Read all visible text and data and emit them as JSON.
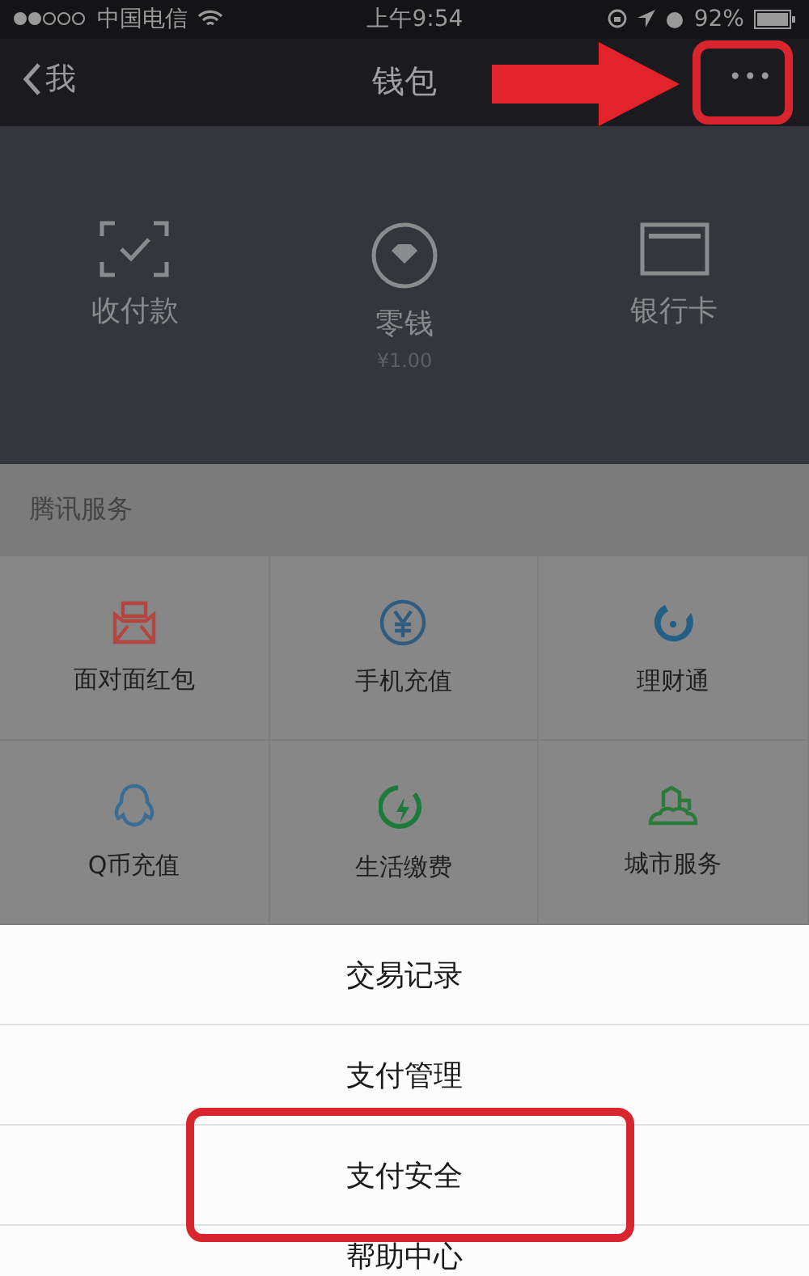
{
  "status_bar": {
    "carrier": "中国电信",
    "time": "上午9:54",
    "battery": "92%"
  },
  "nav": {
    "back_label": "我",
    "title": "钱包",
    "more": "•••",
    "more_annotated": true
  },
  "wallet_items": [
    {
      "label": "收付款"
    },
    {
      "label": "零钱",
      "sub": "¥1.00"
    },
    {
      "label": "银行卡"
    }
  ],
  "section_title": "腾讯服务",
  "services": [
    {
      "label": "面对面红包",
      "color": "#b5453f"
    },
    {
      "label": "手机充值",
      "color": "#2f5d80"
    },
    {
      "label": "理财通",
      "color": "#245f86"
    },
    {
      "label": "Q币充值",
      "color": "#3a6d93"
    },
    {
      "label": "生活缴费",
      "color": "#1d7a3a"
    },
    {
      "label": "城市服务",
      "color": "#2a7a3c"
    }
  ],
  "action_sheet": [
    {
      "label": "交易记录",
      "annotated": false
    },
    {
      "label": "支付管理",
      "annotated": false
    },
    {
      "label": "支付安全",
      "annotated": true
    },
    {
      "label": "帮助中心",
      "annotated": false
    }
  ]
}
